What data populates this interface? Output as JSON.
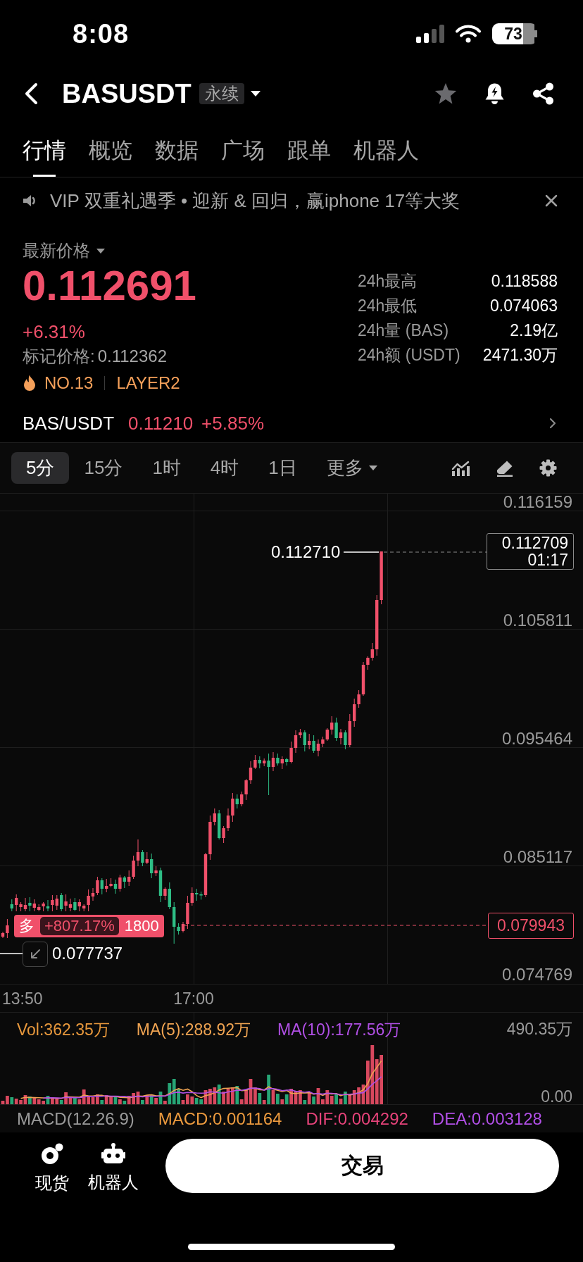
{
  "status_bar": {
    "time": "8:08",
    "battery": "73"
  },
  "header": {
    "title": "BASUSDT",
    "badge": "永续"
  },
  "tabs": [
    {
      "label": "行情",
      "selected": true
    },
    {
      "label": "概览",
      "selected": false
    },
    {
      "label": "数据",
      "selected": false
    },
    {
      "label": "广场",
      "selected": false
    },
    {
      "label": "跟单",
      "selected": false
    },
    {
      "label": "机器人",
      "selected": false
    }
  ],
  "banner": {
    "text": "VIP 双重礼遇季 • 迎新 & 回归，赢iphone 17等大奖"
  },
  "price_panel": {
    "price_type": "最新价格",
    "last_price": "0.112691",
    "change": "+6.31%",
    "mark_price_label": "标记价格:",
    "mark_price": "0.112362",
    "rank": "NO.13",
    "sector": "LAYER2",
    "stats": [
      {
        "label": "24h最高",
        "value": "0.118588"
      },
      {
        "label": "24h最低",
        "value": "0.074063"
      },
      {
        "label": "24h量 (BAS)",
        "value": "2.19亿"
      },
      {
        "label": "24h额 (USDT)",
        "value": "2471.30万"
      }
    ]
  },
  "spot_pair": {
    "pair": "BAS/USDT",
    "price": "0.11210",
    "change": "+5.85%"
  },
  "intervals": [
    {
      "label": "5分",
      "kind": "interval",
      "selected": true
    },
    {
      "label": "15分",
      "kind": "interval",
      "selected": false
    },
    {
      "label": "1时",
      "kind": "interval",
      "selected": false
    },
    {
      "label": "4时",
      "kind": "interval",
      "selected": false
    },
    {
      "label": "1日",
      "kind": "interval",
      "selected": false
    },
    {
      "label": "更多",
      "kind": "menu",
      "selected": false
    }
  ],
  "chart": {
    "y_axis": [
      "0.116159",
      "0.105811",
      "0.095464",
      "0.085117",
      "0.074769"
    ],
    "x_axis": [
      "13:50",
      "17:00"
    ],
    "high_label": "0.112710",
    "last_price": "0.112709",
    "countdown": "01:17",
    "position": {
      "side": "多",
      "pnl": "+807.17%",
      "size": "1800",
      "entry_price": "0.079943"
    },
    "low_label": "0.077737"
  },
  "volume": {
    "legend": [
      {
        "label": "Vol:362.35万",
        "color": "#e8983c"
      },
      {
        "label": "MA(5):288.92万",
        "color": "#f0a452"
      },
      {
        "label": "MA(10):177.56万",
        "color": "#b04fe4"
      }
    ],
    "y_axis": [
      "490.35万",
      "0.00"
    ]
  },
  "macd": {
    "legend": [
      {
        "label": "MACD(12.26.9)",
        "color": "#9a9a9a"
      },
      {
        "label": "MACD:0.001164",
        "color": "#ec9a3e"
      },
      {
        "label": "DIF:0.004292",
        "color": "#e6437a"
      },
      {
        "label": "DEA:0.003128",
        "color": "#b14fe6"
      }
    ]
  },
  "bottom_bar": {
    "shortcuts": [
      {
        "label": "现货",
        "kind": "spot"
      },
      {
        "label": "机器人",
        "kind": "robot"
      }
    ],
    "trade_button": "交易"
  }
}
